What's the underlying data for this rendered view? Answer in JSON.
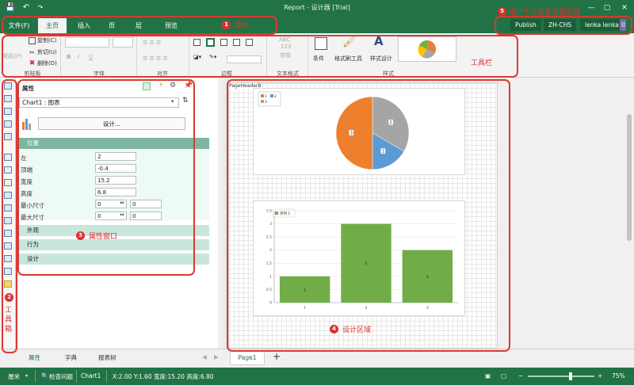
{
  "title": "Report - 设计器 [Trial]",
  "menu": {
    "tabs": [
      {
        "label": "文件(F)"
      },
      {
        "label": "主页"
      },
      {
        "label": "插入"
      },
      {
        "label": "页"
      },
      {
        "label": "层"
      },
      {
        "label": "预览"
      }
    ],
    "active_tab": "主页",
    "user_buttons": [
      "Publish",
      "ZH-CHS",
      "lenka lenka"
    ],
    "user_initial": "II"
  },
  "ribbon": {
    "paste": "粘贴(P)",
    "copy": "复制(C)",
    "cut": "剪切(U)",
    "delete": "删除(D)",
    "clipboard": "剪贴板",
    "font": "字体",
    "align": "对齐",
    "border": "边框",
    "textfmt_sample": "ABC",
    "textfmt_sample2": "123",
    "textfmt_normal": "常规",
    "textfmt": "文本格式",
    "condition": "条件",
    "format_painter": "格式刷工具",
    "style_design": "样式设计",
    "style": "样式",
    "pie_legend_items": [
      "1",
      "2",
      "3"
    ]
  },
  "annotations": {
    "menu": {
      "num": "1",
      "text": "菜单"
    },
    "toolbox": {
      "num": "2",
      "text": "工\n具\n箱"
    },
    "props": {
      "num": "3",
      "text": "属性窗口"
    },
    "design": {
      "num": "4",
      "text": "设计区域"
    },
    "user": {
      "num": "5",
      "text": "用户个人信息设置区域"
    },
    "ribbon": {
      "text": "工具栏"
    }
  },
  "props": {
    "header": "属性",
    "component": "Chart1 : 图表",
    "design_button": "设计...",
    "sections": {
      "position": "位置",
      "appearance": "外观",
      "behavior": "行为",
      "design": "设计"
    },
    "fields": [
      {
        "label": "左",
        "value": "2"
      },
      {
        "label": "顶端",
        "value": "-0.4"
      },
      {
        "label": "宽度",
        "value": "15.2"
      },
      {
        "label": "高度",
        "value": "6.8"
      }
    ],
    "min_size": {
      "label": "最小尺寸",
      "v1": "0",
      "v2": "0"
    },
    "max_size": {
      "label": "最大尺寸",
      "v1": "0",
      "v2": "0"
    }
  },
  "canvas": {
    "band_label": "PageHeaderB",
    "pie_legend": [
      "1",
      "2",
      "3"
    ],
    "bar_legend": "序列 1"
  },
  "bottom": {
    "panel_tabs": [
      "属性",
      "字典",
      "报表树"
    ],
    "page_tab": "Page1",
    "add": "+"
  },
  "status": {
    "unit": "厘米",
    "check": "检查问题",
    "component": "Chart1",
    "coords": "X:2.00 Y:1.60 宽度:15.20 高度:6.80",
    "zoom": "75%"
  },
  "chart_data": [
    {
      "type": "pie",
      "categories": [
        "1",
        "2",
        "3"
      ],
      "values": [
        3,
        1,
        2
      ],
      "data_labels": [
        "3",
        "1",
        "2"
      ],
      "colors": [
        "#ee7f2d",
        "#5b9bd5",
        "#a5a5a5"
      ],
      "legend": "top-left"
    },
    {
      "type": "bar",
      "categories": [
        "1",
        "2",
        "3"
      ],
      "series": [
        {
          "name": "序列 1",
          "values": [
            1,
            3,
            2
          ]
        }
      ],
      "data_labels": [
        "1",
        "3",
        "2"
      ],
      "ylim": [
        0,
        3.5
      ],
      "yticks": [
        "0",
        "0.5",
        "1",
        "1.5",
        "2",
        "2.5",
        "3",
        "3.5"
      ],
      "color": "#70ad47",
      "legend": "top-left"
    }
  ]
}
